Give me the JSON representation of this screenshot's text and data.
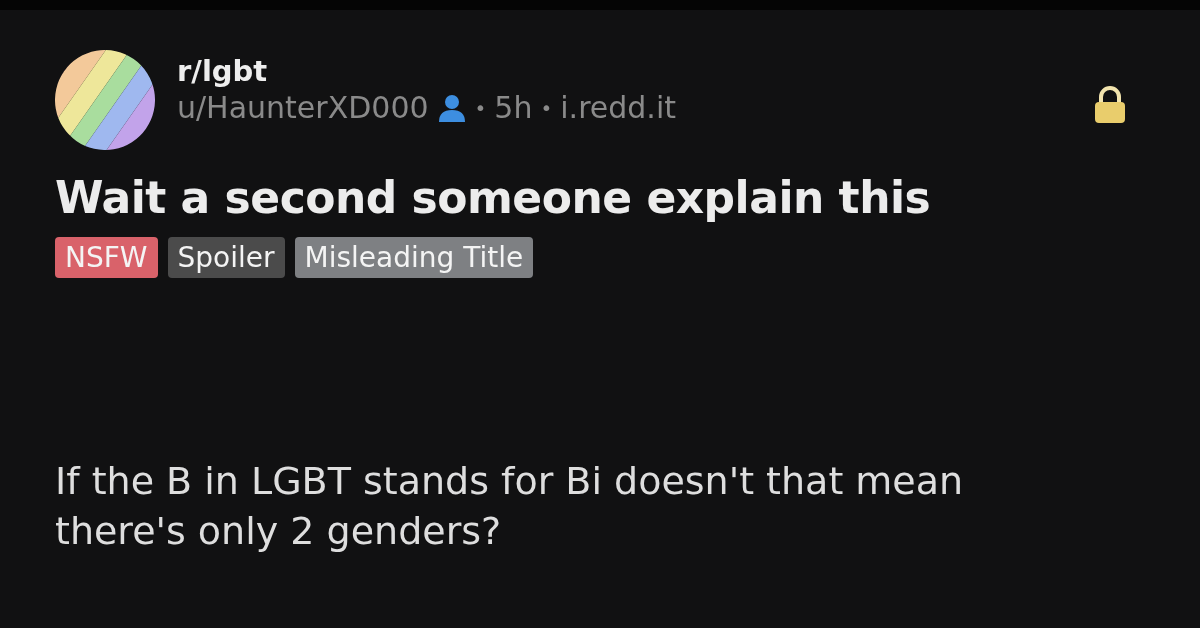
{
  "post": {
    "subreddit": "r/lgbt",
    "meta": {
      "author": "u/HaunterXD000",
      "dot_1": "•",
      "time": "5h",
      "dot_2": "•",
      "domain": "i.redd.it"
    },
    "locked": true,
    "title": "Wait a second someone explain this",
    "tags": [
      {
        "label": "NSFW",
        "color": "#d9626a"
      },
      {
        "label": "Spoiler",
        "color": "#4b4b4b"
      },
      {
        "label": "Misleading Title",
        "color": "#7e8083"
      }
    ],
    "body": "If the B in LGBT stands for Bi doesn't that mean there's only 2 genders?"
  }
}
